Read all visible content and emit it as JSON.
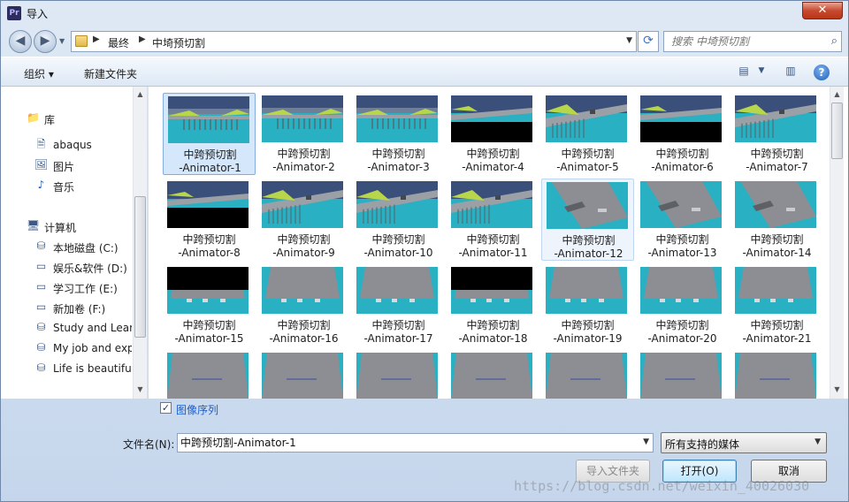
{
  "window": {
    "app_icon": "Pr",
    "title": "导入",
    "close_glyph": "✕"
  },
  "address": {
    "crumbs": [
      "最终",
      "中埼预切割"
    ],
    "search_placeholder": "搜索 中埼预切割"
  },
  "toolbar": {
    "organize": "组织 ▾",
    "new_folder": "新建文件夹"
  },
  "sidebar": {
    "items": [
      {
        "label": "库",
        "icon": "library-icon",
        "level": "top"
      },
      {
        "label": "abaqus",
        "icon": "document-icon",
        "level": "child"
      },
      {
        "label": "图片",
        "icon": "pictures-icon",
        "level": "child"
      },
      {
        "label": "音乐",
        "icon": "music-icon",
        "level": "child"
      },
      {
        "label": "计算机",
        "icon": "computer-icon",
        "level": "top"
      },
      {
        "label": "本地磁盘 (C:)",
        "icon": "system-drive-icon",
        "level": "child"
      },
      {
        "label": "娱乐&软件 (D:)",
        "icon": "drive-icon",
        "level": "child"
      },
      {
        "label": "学习工作 (E:)",
        "icon": "drive-icon",
        "level": "child"
      },
      {
        "label": "新加卷 (F:)",
        "icon": "drive-icon",
        "level": "child"
      },
      {
        "label": "Study and Learning",
        "icon": "network-drive-icon",
        "level": "child"
      },
      {
        "label": "My job and experience",
        "icon": "network-drive-icon",
        "level": "child"
      },
      {
        "label": "Life is beautiful",
        "icon": "network-drive-icon",
        "level": "child"
      }
    ]
  },
  "files": [
    {
      "line1": "中跨预切割",
      "line2": "-Animator-1",
      "thumb": "bridge-far",
      "state": "selected"
    },
    {
      "line1": "中跨预切割",
      "line2": "-Animator-2",
      "thumb": "bridge-far"
    },
    {
      "line1": "中跨预切割",
      "line2": "-Animator-3",
      "thumb": "bridge-far"
    },
    {
      "line1": "中跨预切割",
      "line2": "-Animator-4",
      "thumb": "bridge-black"
    },
    {
      "line1": "中跨预切割",
      "line2": "-Animator-5",
      "thumb": "bridge-diag"
    },
    {
      "line1": "中跨预切割",
      "line2": "-Animator-6",
      "thumb": "bridge-black"
    },
    {
      "line1": "中跨预切割",
      "line2": "-Animator-7",
      "thumb": "bridge-diag"
    },
    {
      "line1": "中跨预切割",
      "line2": "-Animator-8",
      "thumb": "bridge-black"
    },
    {
      "line1": "中跨预切割",
      "line2": "-Animator-9",
      "thumb": "bridge-diag"
    },
    {
      "line1": "中跨预切割",
      "line2": "-Animator-10",
      "thumb": "bridge-diag"
    },
    {
      "line1": "中跨预切割",
      "line2": "-Animator-11",
      "thumb": "bridge-diag"
    },
    {
      "line1": "中跨预切割",
      "line2": "-Animator-12",
      "thumb": "deck-tilt",
      "state": "hover"
    },
    {
      "line1": "中跨预切割",
      "line2": "-Animator-13",
      "thumb": "deck-tilt"
    },
    {
      "line1": "中跨预切割",
      "line2": "-Animator-14",
      "thumb": "deck-tilt"
    },
    {
      "line1": "中跨预切割",
      "line2": "-Animator-15",
      "thumb": "deck-black"
    },
    {
      "line1": "中跨预切割",
      "line2": "-Animator-16",
      "thumb": "deck"
    },
    {
      "line1": "中跨预切割",
      "line2": "-Animator-17",
      "thumb": "deck"
    },
    {
      "line1": "中跨预切割",
      "line2": "-Animator-18",
      "thumb": "deck-black"
    },
    {
      "line1": "中跨预切割",
      "line2": "-Animator-19",
      "thumb": "deck"
    },
    {
      "line1": "中跨预切割",
      "line2": "-Animator-20",
      "thumb": "deck"
    },
    {
      "line1": "中跨预切割",
      "line2": "-Animator-21",
      "thumb": "deck"
    },
    {
      "line1": "",
      "line2": "",
      "thumb": "deck-close"
    },
    {
      "line1": "",
      "line2": "",
      "thumb": "deck-close"
    },
    {
      "line1": "",
      "line2": "",
      "thumb": "deck-close"
    },
    {
      "line1": "",
      "line2": "",
      "thumb": "deck-close"
    },
    {
      "line1": "",
      "line2": "",
      "thumb": "deck-close"
    },
    {
      "line1": "",
      "line2": "",
      "thumb": "deck-close"
    },
    {
      "line1": "",
      "line2": "",
      "thumb": "deck-close"
    }
  ],
  "options": {
    "image_sequence_label": "图像序列",
    "image_sequence_checked": true
  },
  "footer": {
    "filename_label": "文件名(N):",
    "filename_value": "中跨预切割-Animator-1",
    "filetype_value": "所有支持的媒体",
    "import_folder_label": "导入文件夹",
    "open_label": "打开(O)",
    "cancel_label": "取消"
  },
  "watermark": "https://blog.csdn.net/weixin_40026030",
  "colors": {
    "sky": "#3a4f7a",
    "water": "#2ab0c3",
    "deck": "#8c8e93",
    "selection": "#d5e7fb",
    "link": "#1d5ec8"
  }
}
